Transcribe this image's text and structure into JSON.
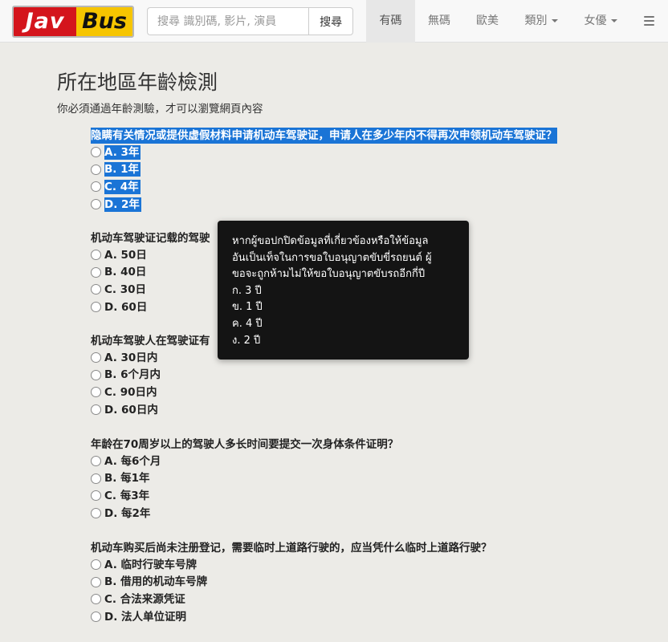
{
  "logo": {
    "left": "Jav",
    "right": "Bus"
  },
  "search": {
    "placeholder": "搜尋 識別碼, 影片, 演員",
    "button": "搜尋"
  },
  "nav": [
    {
      "label": "有碼",
      "active": true
    },
    {
      "label": "無碼"
    },
    {
      "label": "歐美"
    },
    {
      "label": "類別",
      "dropdown": true
    },
    {
      "label": "女優",
      "dropdown": true
    }
  ],
  "page": {
    "title": "所在地區年齡檢測",
    "subtitle": "你必須通過年齡測驗，才可以瀏覽網頁內容"
  },
  "questions": [
    {
      "text": "隐瞒有关情况或提供虚假材料申请机动车驾驶证，申请人在多少年内不得再次申领机动车驾驶证？",
      "options": [
        "A. 3年",
        "B. 1年",
        "C. 4年",
        "D. 2年"
      ]
    },
    {
      "text": "机动车驾驶证记载的驾驶",
      "options": [
        "A. 50日",
        "B. 40日",
        "C. 30日",
        "D. 60日"
      ]
    },
    {
      "text": "机动车驾驶人在驾驶证有",
      "options": [
        "A. 30日内",
        "B. 6个月内",
        "C. 90日内",
        "D. 60日内"
      ]
    },
    {
      "text": "年龄在70周岁以上的驾驶人多长时间要提交一次身体条件证明？",
      "options": [
        "A. 每6个月",
        "B. 每1年",
        "C. 每3年",
        "D. 每2年"
      ]
    },
    {
      "text": "机动车购买后尚未注册登记，需要临时上道路行驶的，应当凭什么临时上道路行驶？",
      "options": [
        "A. 临时行驶车号牌",
        "B. 借用的机动车号牌",
        "C. 合法来源凭证",
        "D. 法人单位证明"
      ]
    }
  ],
  "tooltip": {
    "lines": [
      "หากผู้ขอปกปิดข้อมูลที่เกี่ยวข้องหรือให้ข้อมูล",
      "อันเป็นเท็จในการขอใบอนุญาตขับขี่รถยนต์ ผู้",
      "ขอจะถูกห้ามไม่ให้ขอใบอนุญาตขับรถอีกกี่ปี",
      "ก. 3 ปี",
      "ข. 1 ปี",
      "ค. 4 ปี",
      "ง. 2 ปี"
    ]
  },
  "colors": {
    "selection": "#1a74d6",
    "tooltip_bg": "#141414",
    "logo_red": "#d4151c",
    "logo_yellow": "#f6c500"
  },
  "icons": {
    "menu": "hamburger-icon",
    "dropdown": "caret-down-icon"
  }
}
